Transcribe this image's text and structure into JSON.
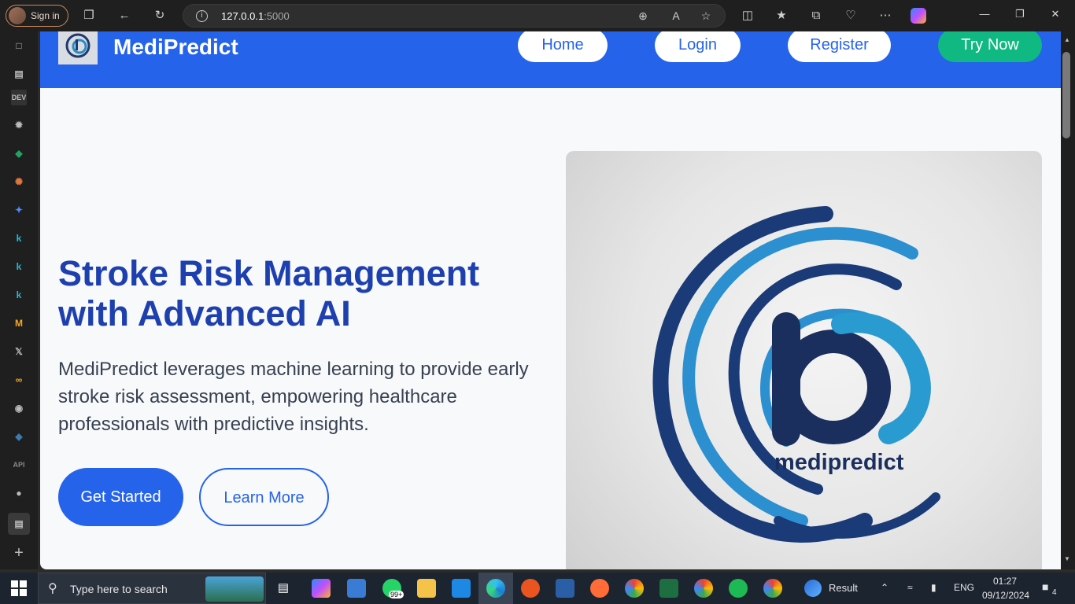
{
  "browser": {
    "signin_label": "Sign in",
    "url_host": "127.0.0.1",
    "url_port": ":5000"
  },
  "nav": {
    "brand": "MediPredict",
    "home": "Home",
    "login": "Login",
    "register": "Register",
    "try_now": "Try Now"
  },
  "hero": {
    "title": "Stroke Risk Management with Advanced AI",
    "subtitle": "MediPredict leverages machine learning to provide early stroke risk assessment, empowering healthcare professionals with predictive insights.",
    "get_started": "Get Started",
    "learn_more": "Learn More",
    "logo_text": "medipredict"
  },
  "taskbar": {
    "search_placeholder": "Type here to search",
    "whatsapp_badge": "99+",
    "result_label": "Result",
    "language": "ENG",
    "time": "01:27",
    "date": "09/12/2024",
    "notification_count": "4"
  },
  "colors": {
    "primary": "#2563eb",
    "heading": "#1e40af",
    "accent_green": "#10b981"
  }
}
